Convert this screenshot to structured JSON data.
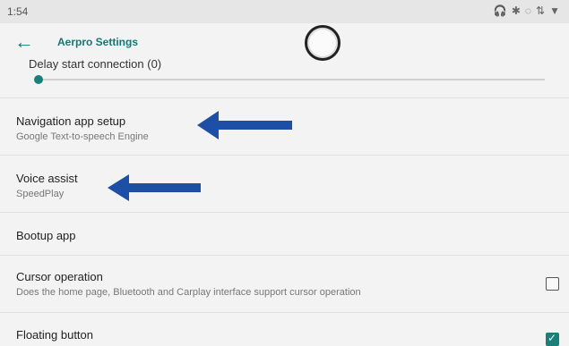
{
  "status_bar": {
    "time": "1:54",
    "icons": [
      "headphones-icon",
      "bluetooth-icon",
      "location-icon",
      "data-icon",
      "wifi-icon"
    ]
  },
  "app_bar": {
    "title": "Aerpro Settings"
  },
  "delay": {
    "label": "Delay start connection (0)",
    "value_fraction": 0.0
  },
  "settings": [
    {
      "title": "Navigation app setup",
      "subtitle": "Google Text-to-speech Engine"
    },
    {
      "title": "Voice assist",
      "subtitle": "SpeedPlay"
    },
    {
      "title": "Bootup app",
      "subtitle": ""
    },
    {
      "title": "Cursor operation",
      "subtitle": "Does the home page, Bluetooth and Carplay interface support cursor operation",
      "checked": false
    },
    {
      "title": "Floating button",
      "subtitle": "",
      "checked": true
    }
  ],
  "colors": {
    "accent": "#1a7f79",
    "arrow": "#1e4fa6"
  }
}
